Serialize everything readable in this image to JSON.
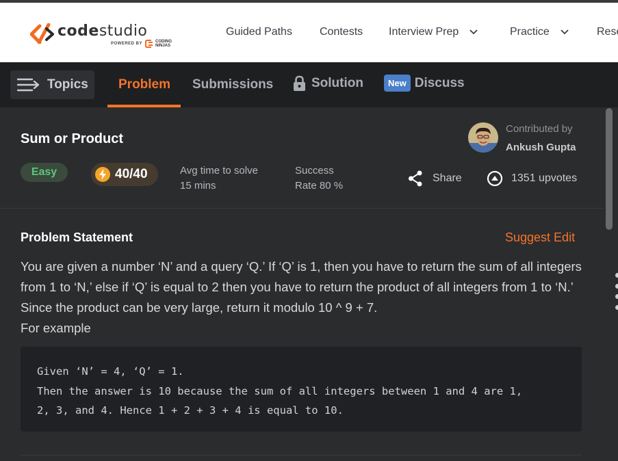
{
  "nav": {
    "logo_word_code": "code",
    "logo_word_studio": "studio",
    "powered_by": "POWERED BY",
    "brand_coding": "CODING",
    "brand_ninjas": "NINJAS",
    "links": [
      "Guided Paths",
      "Contests",
      "Interview Prep",
      "Practice",
      "Rese"
    ]
  },
  "tabs": {
    "topics": "Topics",
    "problem": "Problem",
    "submissions": "Submissions",
    "solution": "Solution",
    "new_badge": "New",
    "discuss": "Discuss"
  },
  "problem": {
    "title": "Sum or Product",
    "difficulty": "Easy",
    "score": "40/40",
    "avg_time_label": "Avg time to solve",
    "avg_time_value": "15 mins",
    "success_label": "Success",
    "success_value": "Rate 80 %",
    "contributed_label": "Contributed by",
    "contributor": "Ankush Gupta",
    "share_label": "Share",
    "upvotes": "1351 upvotes"
  },
  "statement": {
    "heading": "Problem Statement",
    "suggest_edit": "Suggest Edit",
    "text": "You are given a number ‘N’ and a query ‘Q.’ If ‘Q’ is 1, then you have to return the sum of all integers from 1 to ‘N,’ else if ‘Q’ is equal to 2 then you have to return the product of all integers from 1 to ‘N.’ Since the product can be very large, return it modulo 10 ^ 9 + 7.",
    "for_example": "For example",
    "code_lines": [
      "Given ‘N’ = 4, ‘Q’ = 1.",
      "Then the answer is 10 because the sum of all integers between 1 and 4 are 1,",
      "2, 3, and 4. Hence 1 + 2 + 3 + 4 is equal to 10."
    ]
  },
  "colors": {
    "accent": "#f4742a",
    "easy_green": "#5fc47c",
    "new_blue": "#4a7fc9"
  }
}
